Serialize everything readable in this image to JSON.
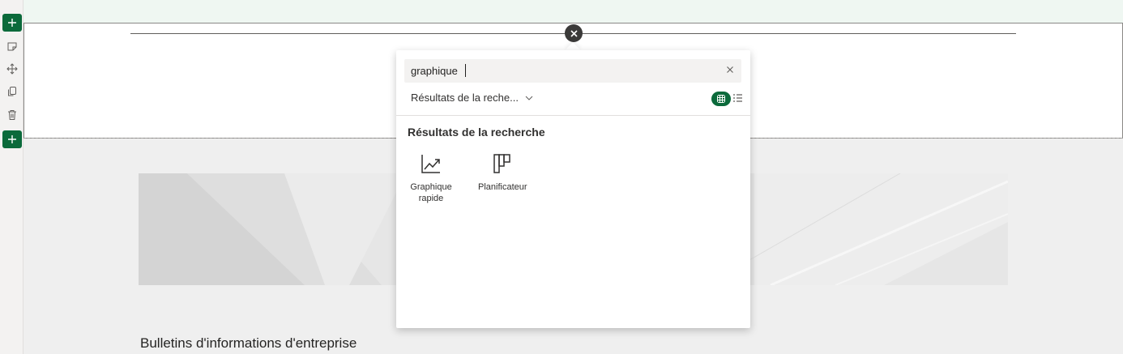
{
  "toolbar": {
    "items": [
      "add-section-icon",
      "edit-section-icon",
      "move-section-icon",
      "duplicate-section-icon",
      "delete-section-icon",
      "add-section-icon"
    ]
  },
  "picker": {
    "search": {
      "value": "graphique",
      "placeholder": ""
    },
    "filter_label": "Résultats de la reche...",
    "results_heading": "Résultats de la recherche",
    "results": [
      {
        "label": "Graphique rapide",
        "icon": "line-chart-icon"
      },
      {
        "label": "Planificateur",
        "icon": "planner-icon"
      }
    ],
    "view_modes": [
      "grid-view-icon",
      "list-view-icon"
    ]
  },
  "page": {
    "news_title": "Bulletins d'informations d'entreprise"
  },
  "colors": {
    "accent": "#0b6a3b",
    "top_band": "#eff7f2",
    "panel_bg": "#ffffff",
    "page_bg": "#efefef"
  }
}
